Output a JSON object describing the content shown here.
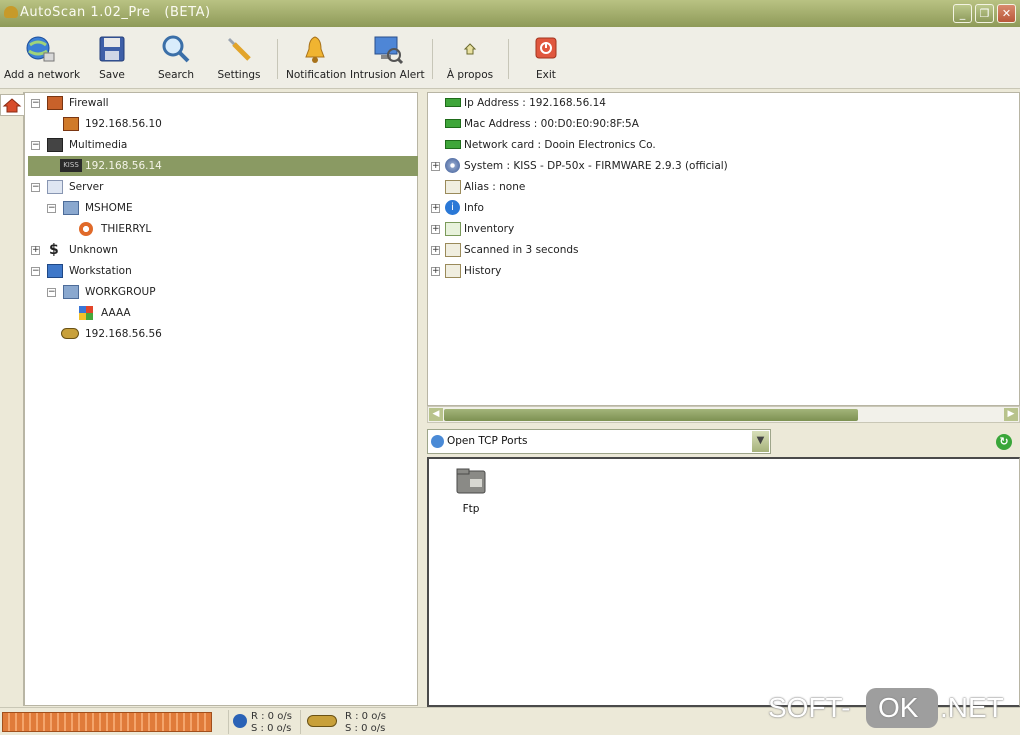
{
  "window": {
    "title": "AutoScan 1.02_Pre   (BETA)"
  },
  "toolbar": {
    "add_network": "Add a network",
    "save": "Save",
    "search": "Search",
    "settings": "Settings",
    "notification": "Notification",
    "intrusion_alert": "Intrusion Alert",
    "apropos": "À propos",
    "exit": "Exit"
  },
  "tree": {
    "firewall": "Firewall",
    "fw_host": "192.168.56.10",
    "multimedia": "Multimedia",
    "mm_host": "192.168.56.14",
    "mm_host_badge": "KISS",
    "server": "Server",
    "mshome": "MSHOME",
    "thierryl": "THIERRYL",
    "unknown": "Unknown",
    "workstation": "Workstation",
    "workgroup": "WORKGROUP",
    "aaaa": "AAAA",
    "ws_host": "192.168.56.56"
  },
  "details": {
    "ip": "Ip Address : 192.168.56.14",
    "mac": "Mac Address : 00:D0:E0:90:8F:5A",
    "card": "Network card : Dooin Electronics Co.",
    "system": "System : KISS - DP-50x - FIRMWARE 2.9.3 (official)",
    "alias": "Alias : none",
    "info": "Info",
    "inventory": "Inventory",
    "scanned": "Scanned in 3 seconds",
    "history": "History"
  },
  "ports": {
    "selected": "Open TCP Ports",
    "items": [
      "Ftp"
    ]
  },
  "status": {
    "net1_r": "R : 0 o/s",
    "net1_s": "S : 0 o/s",
    "net2_r": "R : 0 o/s",
    "net2_s": "S : 0 o/s"
  },
  "watermark": {
    "left": "SOFT-",
    "ok": "OK",
    "right": ".NET"
  },
  "colors": {
    "titlebar": "#9aa666",
    "selection": "#8a9a63",
    "progress": "#e07b3a"
  }
}
